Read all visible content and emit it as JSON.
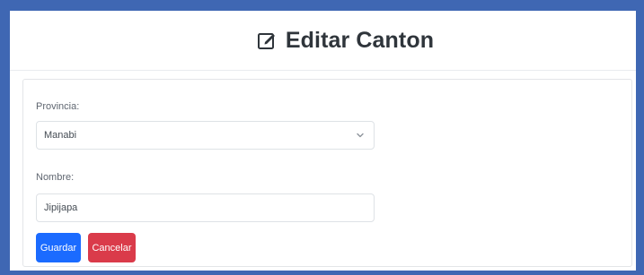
{
  "header": {
    "title": "Editar Canton",
    "icon": "edit-square-icon"
  },
  "form": {
    "provincia_label": "Provincia:",
    "provincia_value": "Manabi",
    "nombre_label": "Nombre:",
    "nombre_value": "Jipijapa"
  },
  "actions": {
    "save_label": "Guardar",
    "cancel_label": "Cancelar"
  },
  "colors": {
    "frame": "#3f67b3",
    "primary": "#1b6bff",
    "danger": "#da3b4a"
  }
}
